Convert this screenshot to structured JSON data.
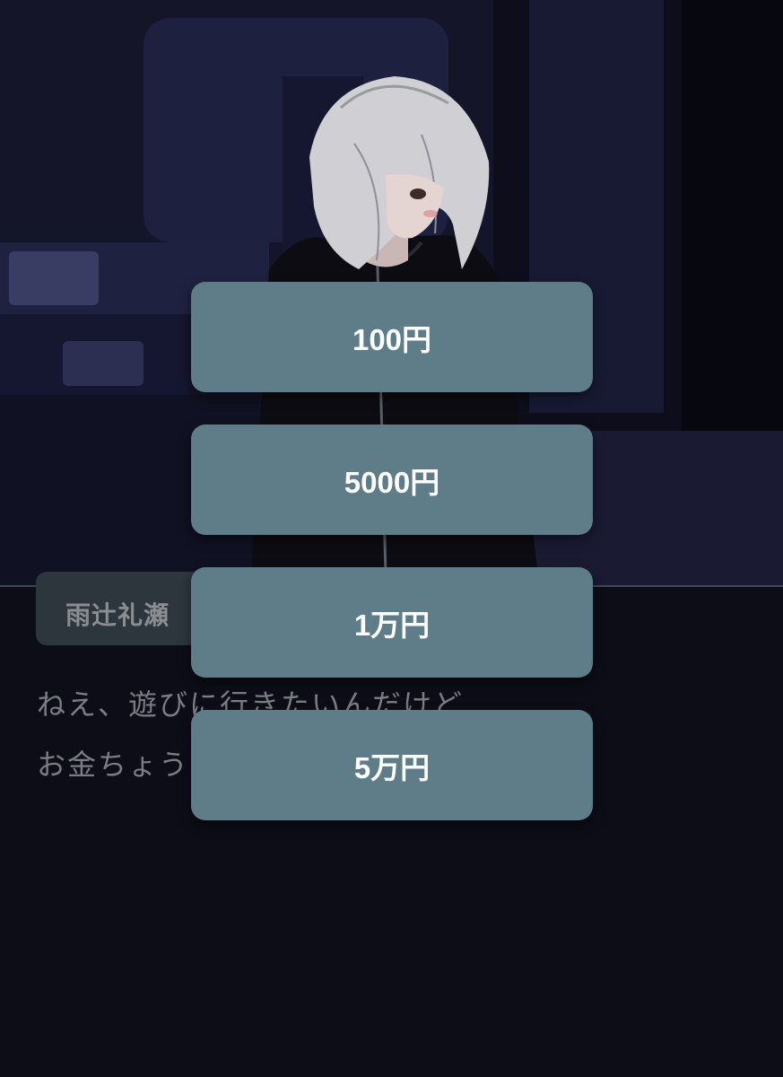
{
  "scene": {
    "background": "dark-bedroom-night",
    "character": "silver-haired-boy-black-hoodie"
  },
  "speaker": {
    "name": "雨辻礼瀬"
  },
  "dialogue": {
    "line1": "ねえ、遊びに行きたいんだけど",
    "line2": "お金ちょう"
  },
  "choices": [
    {
      "label": "100円"
    },
    {
      "label": "5000円"
    },
    {
      "label": "1万円"
    },
    {
      "label": "5万円"
    }
  ],
  "colors": {
    "choice_bg": "#5f7c89",
    "choice_text": "#ffffff",
    "window_bg": "#0c0d17",
    "name_plate_bg": "#2d363d"
  }
}
